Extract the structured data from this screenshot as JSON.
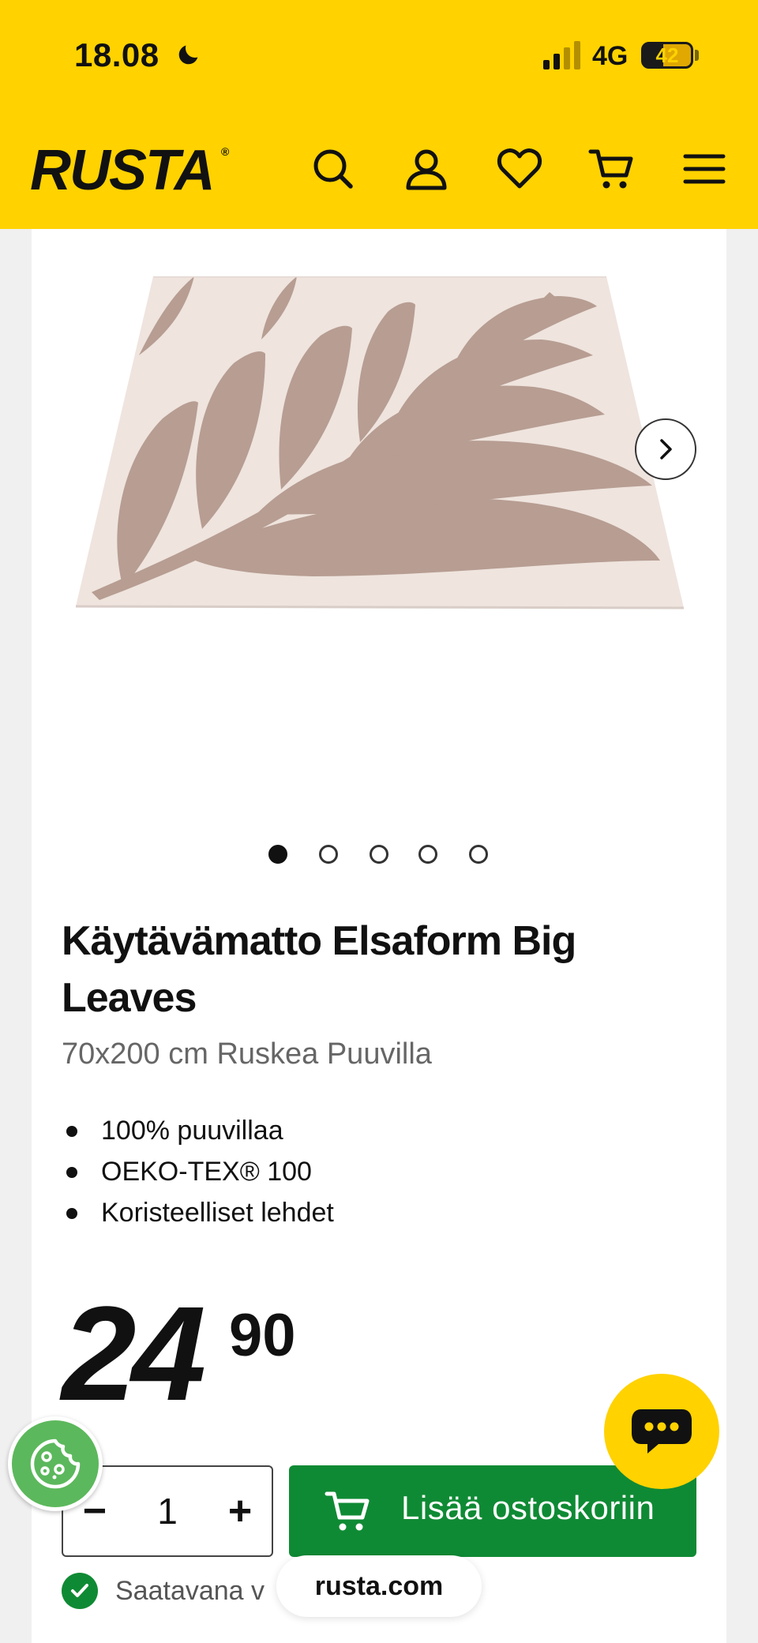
{
  "status_bar": {
    "time": "18.08",
    "network": "4G",
    "battery": "42",
    "battery_percent": 42
  },
  "header": {
    "logo": "RUSTA",
    "logo_mark": "®"
  },
  "product": {
    "title": "Käytävämatto Elsaform Big Leaves",
    "subtitle": "70x200 cm Ruskea Puuvilla",
    "features": [
      "100% puuvillaa",
      "OEKO-TEX® 100",
      "Koristeelliset lehdet"
    ],
    "price_int": "24",
    "price_dec": "90",
    "image_count": 5,
    "active_image": 1,
    "colors": {
      "rug_base": "#efe4de",
      "rug_leaf": "#b79d92"
    }
  },
  "cart": {
    "minus": "−",
    "quantity": "1",
    "plus": "+",
    "add_label": "Lisää ostoskoriin"
  },
  "availability": {
    "text": "Saatavana v"
  },
  "browser": {
    "url": "rusta.com"
  },
  "icons": [
    "moon-icon",
    "signal-icon",
    "search-icon",
    "user-icon",
    "heart-icon",
    "cart-icon",
    "menu-icon",
    "chevron-right-icon",
    "chat-icon",
    "cookie-icon",
    "check-icon"
  ],
  "colors": {
    "brand_yellow": "#ffd200",
    "cta_green": "#0f8a34",
    "cookie_green": "#5cb85c"
  }
}
